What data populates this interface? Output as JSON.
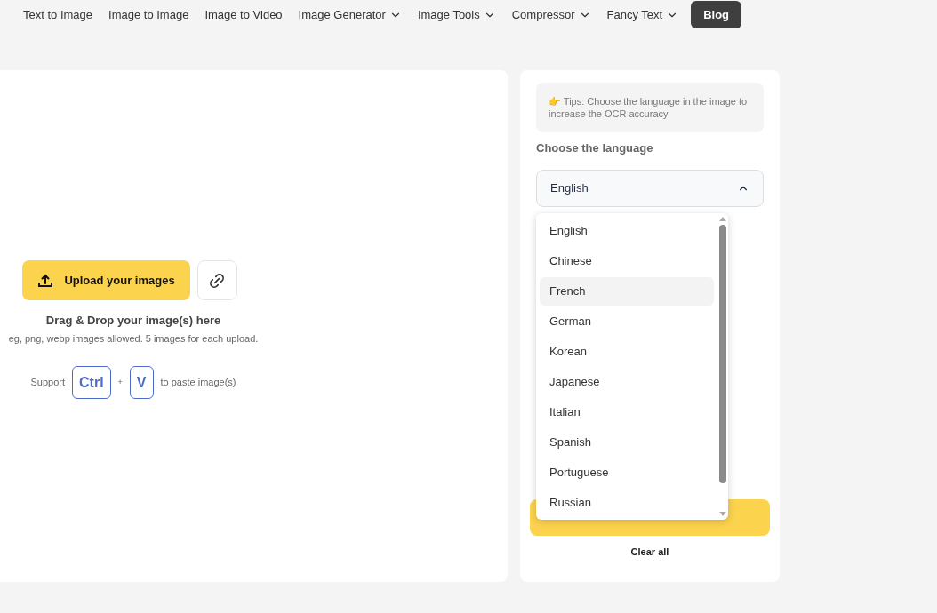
{
  "nav": [
    {
      "label": "Text to Image",
      "caret": false
    },
    {
      "label": "Image to Image",
      "caret": false
    },
    {
      "label": "Image to Video",
      "caret": false
    },
    {
      "label": "Image Generator",
      "caret": true
    },
    {
      "label": "Image Tools",
      "caret": true
    },
    {
      "label": "Compressor",
      "caret": true
    },
    {
      "label": "Fancy Text",
      "caret": true
    }
  ],
  "blog_button": "Blog",
  "upload": {
    "button": "Upload your images",
    "drag_title": "Drag & Drop your image(s) here",
    "allowed": "eg, png, webp images allowed. 5 images for each upload.",
    "support": "Support",
    "key_1": "Ctrl",
    "plus": "+",
    "key_2": "V",
    "paste": "to paste image(s)"
  },
  "tips": {
    "icon": "👉",
    "text": "Tips: Choose the language in the image to increase the OCR accuracy"
  },
  "language_label": "Choose the language",
  "language_select": {
    "value": "English",
    "expanded": true
  },
  "languages": [
    {
      "label": "English",
      "selected": false
    },
    {
      "label": "Chinese",
      "selected": false
    },
    {
      "label": "French",
      "selected": true
    },
    {
      "label": "German",
      "selected": false
    },
    {
      "label": "Korean",
      "selected": false
    },
    {
      "label": "Japanese",
      "selected": false
    },
    {
      "label": "Italian",
      "selected": false
    },
    {
      "label": "Spanish",
      "selected": false
    },
    {
      "label": "Portuguese",
      "selected": false
    },
    {
      "label": "Russian",
      "selected": false
    }
  ],
  "clear_all": "Clear all"
}
